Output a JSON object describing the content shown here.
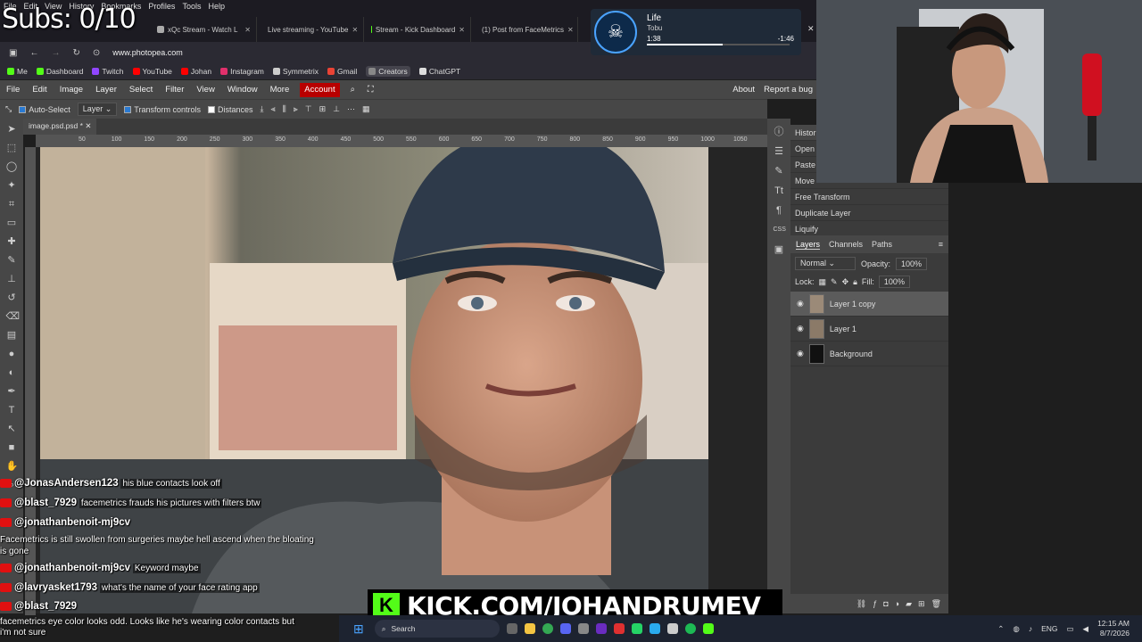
{
  "overlay": {
    "subs": "Subs: 0/10",
    "kick_banner": "KICK.COM/JOHANDRUMEV",
    "kick_logo": "K"
  },
  "browser": {
    "menu": [
      "File",
      "Edit",
      "View",
      "History",
      "Bookmarks",
      "Profiles",
      "Tools",
      "Help"
    ],
    "tabs": [
      {
        "label": "xQc Stream - Watch L",
        "color": "#aaa"
      },
      {
        "label": "Live streaming - YouTube",
        "color": "#ff0000"
      },
      {
        "label": "Stream - Kick Dashboard",
        "color": "#53fc18"
      },
      {
        "label": "(1) Post from FaceMetrics",
        "color": "#e0245e"
      }
    ],
    "url": "www.photopea.com",
    "bookmarks": [
      {
        "label": "Me",
        "color": "#53fc18"
      },
      {
        "label": "Dashboard",
        "color": "#53fc18"
      },
      {
        "label": "Twitch",
        "color": "#9146ff"
      },
      {
        "label": "YouTube",
        "color": "#ff0000"
      },
      {
        "label": "Johan",
        "color": "#ff0000"
      },
      {
        "label": "Instagram",
        "color": "#e1306c"
      },
      {
        "label": "Symmetrix",
        "color": "#cccccc"
      },
      {
        "label": "Gmail",
        "color": "#ea4335"
      },
      {
        "label": "Creators",
        "color": "#888888"
      },
      {
        "label": "ChatGPT",
        "color": "#dddddd"
      }
    ]
  },
  "music": {
    "title": "Life",
    "artist": "Tobu",
    "elapsed": "1:38",
    "remaining": "-1:46",
    "progress": 0.53
  },
  "photopea": {
    "menu": [
      "File",
      "Edit",
      "Image",
      "Layer",
      "Select",
      "Filter",
      "View",
      "Window",
      "More"
    ],
    "account": "Account",
    "right_menu": [
      "About",
      "Report a bug"
    ],
    "options": {
      "auto_select": "Auto-Select",
      "layer_select": "Layer",
      "transform_controls": "Transform controls",
      "distances": "Distances"
    },
    "doc_tab": "image.psd.psd *",
    "ruler_ticks": [
      "50",
      "100",
      "150",
      "200",
      "250",
      "300",
      "350",
      "400",
      "450",
      "500",
      "550",
      "600",
      "650",
      "700",
      "750",
      "800",
      "850",
      "900",
      "950",
      "1000",
      "1050"
    ],
    "history_title": "Histor",
    "history": [
      "Open",
      "Paste",
      "Move",
      "Free Transform",
      "Duplicate Layer",
      "Liquify"
    ],
    "layer_tabs": [
      "Layers",
      "Channels",
      "Paths"
    ],
    "blend_mode": "Normal",
    "opacity_label": "Opacity:",
    "opacity": "100%",
    "lock_label": "Lock:",
    "fill_label": "Fill:",
    "fill": "100%",
    "layers": [
      "Layer 1 copy",
      "Layer 1",
      "Background"
    ]
  },
  "chat": [
    {
      "user": "@JonasAndersen123",
      "msg": "his blue contacts look off"
    },
    {
      "user": "@blast_7929",
      "msg": "facemetrics frauds his pictures with filters btw"
    },
    {
      "user": "@jonathanbenoit-mj9cv",
      "msg": "Facemetrics is still swollen from surgeries maybe hell ascend when the bloating is gone"
    },
    {
      "user": "@jonathanbenoit-mj9cv",
      "msg": "Keyword maybe"
    },
    {
      "user": "@lavryasket1793",
      "msg": "what's the name of your face rating app"
    },
    {
      "user": "@blast_7929",
      "msg": "facemetrics eye color looks odd. Looks like he's wearing color contacts but i'm not sure"
    }
  ],
  "taskbar": {
    "search": "Search",
    "lang": "ENG",
    "time": "12:15 AM",
    "date": "8/7/2026"
  }
}
